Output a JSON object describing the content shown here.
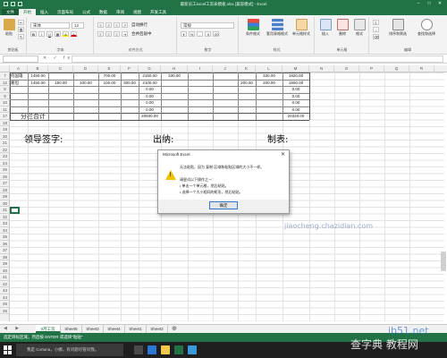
{
  "window": {
    "title": "最新员工excel工资表模板.xlsx [兼容模式] - Excel"
  },
  "ribbon_tabs": [
    "文件",
    "开始",
    "插入",
    "页面布局",
    "公式",
    "数据",
    "审阅",
    "视图",
    "开发工具"
  ],
  "ribbon": {
    "paste_label": "粘贴",
    "clipboard_label": "剪贴板",
    "font_name": "宋体",
    "font_size": "12",
    "font_label": "字体",
    "align_label": "对齐方式",
    "wrap_label": "自动换行",
    "merge_label": "合并后居中",
    "number_format": "常规",
    "number_label": "数字",
    "cond_format_label": "条件格式",
    "table_format_label": "套用表格格式",
    "cell_style_label": "单元格样式",
    "styles_label": "样式",
    "insert_label": "插入",
    "delete_label": "删除",
    "format_label": "格式",
    "cells_label": "单元格",
    "sort_filter_label": "排序和筛选",
    "find_select_label": "查找和选择",
    "edit_label": "编辑"
  },
  "formula_bar": {
    "fx": "✕ ✓ fx"
  },
  "columns": [
    "A",
    "B",
    "C",
    "D",
    "E",
    "F",
    "G",
    "H",
    "I",
    "J",
    "K",
    "L",
    "M",
    "N",
    "O",
    "P",
    "Q",
    "R"
  ],
  "rows": [
    "7",
    "12",
    "8",
    "9",
    "10",
    "11",
    "17",
    "18",
    "19",
    "20",
    "21",
    "22",
    "23",
    "24",
    "25",
    "26",
    "27",
    "28",
    "29",
    "30",
    "31",
    "32",
    "33",
    "34",
    "35",
    "36",
    "37",
    "38",
    "39",
    "40",
    "41",
    "42",
    "43",
    "44",
    "45",
    "46"
  ],
  "sheet_rows": [
    {
      "b": "何国雄",
      "c": "1450.00",
      "d": "",
      "e": "",
      "f": "700.00",
      "g": "",
      "h": "2150.00",
      "i": "330.00",
      "l": "",
      "m": "330.00",
      "n": "1820.00"
    },
    {
      "b": "葛坦",
      "c": "1450.00",
      "d": "150.00",
      "e": "100.00",
      "f": "100.00",
      "g": "300.00",
      "h": "2100.00",
      "i": "",
      "l": "200.00",
      "m": "200.00",
      "n": "1900.00"
    },
    {
      "h": "0.00",
      "n": "0.00"
    },
    {
      "h": "0.00",
      "n": "0.00"
    },
    {
      "h": "0.00",
      "n": "0.00"
    },
    {
      "h": "0.00",
      "n": "0.00"
    }
  ],
  "total_row": {
    "label": "分栏合计",
    "h": "20830.00",
    "n": "20320.00"
  },
  "signatures": {
    "leader": "领导签字:",
    "cashier": "出纳:",
    "maker": "制表:"
  },
  "dialog": {
    "title": "Microsoft Excel",
    "line1": "无法粘贴，因为 复制 区域和粘贴区域的大小不一样。",
    "line2": "请尝试以下操作之一：",
    "line3": "• 单击一个单元格，然后粘贴。",
    "line4": "• 选择一个大小相同的矩形，然后粘贴。",
    "ok": "确定"
  },
  "sheet_tabs": [
    "9月工资",
    "Sheet5",
    "Sheet3",
    "Sheet4",
    "Sheet1",
    "Sheet2"
  ],
  "status": {
    "text": "选定目标区域，然后按 ENTER 或选择\"粘贴\""
  },
  "taskbar": {
    "search": "我是 Cortana，小娜。有问题尽管问我。"
  },
  "watermarks": {
    "a": "ib51.net",
    "b": "jiaocheng.chazidian.com",
    "c": "查字典 教程网"
  },
  "colors": {
    "excel_green": "#217346",
    "warning_yellow": "#f2c200"
  }
}
